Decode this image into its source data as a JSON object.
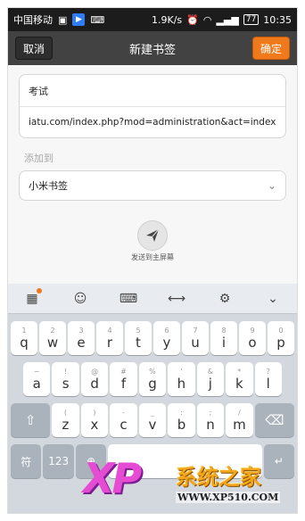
{
  "status_bar": {
    "carrier": "中国移动",
    "speed": "1.9K/s",
    "battery": "77",
    "time": "10:35"
  },
  "titlebar": {
    "cancel_label": "取消",
    "title": "新建书签",
    "confirm_label": "确定"
  },
  "form": {
    "name_value": "考试",
    "url_value": "iatu.com/index.php?mod=administration&act=index",
    "add_to_label": "添加到",
    "folder_value": "小米书签",
    "send_label": "发送到主屏幕"
  },
  "keyboard": {
    "row1": [
      {
        "sym": "1",
        "ch": "q"
      },
      {
        "sym": "2",
        "ch": "w"
      },
      {
        "sym": "3",
        "ch": "e"
      },
      {
        "sym": "4",
        "ch": "r"
      },
      {
        "sym": "5",
        "ch": "t"
      },
      {
        "sym": "6",
        "ch": "y"
      },
      {
        "sym": "7",
        "ch": "u"
      },
      {
        "sym": "8",
        "ch": "i"
      },
      {
        "sym": "9",
        "ch": "o"
      },
      {
        "sym": "0",
        "ch": "p"
      }
    ],
    "row2": [
      {
        "sym": "~",
        "ch": "a"
      },
      {
        "sym": "!",
        "ch": "s"
      },
      {
        "sym": "@",
        "ch": "d"
      },
      {
        "sym": "#",
        "ch": "f"
      },
      {
        "sym": "%",
        "ch": "g"
      },
      {
        "sym": "'",
        "ch": "h"
      },
      {
        "sym": "&",
        "ch": "j"
      },
      {
        "sym": "*",
        "ch": "k"
      },
      {
        "sym": "?",
        "ch": "l"
      }
    ],
    "row3": [
      {
        "sym": "(",
        "ch": "z"
      },
      {
        "sym": ")",
        "ch": "x"
      },
      {
        "sym": "-",
        "ch": "c"
      },
      {
        "sym": "_",
        "ch": "v"
      },
      {
        "sym": ":",
        "ch": "b"
      },
      {
        "sym": ";",
        "ch": "n"
      },
      {
        "sym": "/",
        "ch": "m"
      }
    ],
    "symbol_key": "符",
    "number_key": "123"
  },
  "watermark": {
    "logo": "XP",
    "brand": "系统之家",
    "url": "WWW.XP510.COM"
  },
  "colors": {
    "accent": "#f07a1b",
    "titlebar": "#424242"
  }
}
